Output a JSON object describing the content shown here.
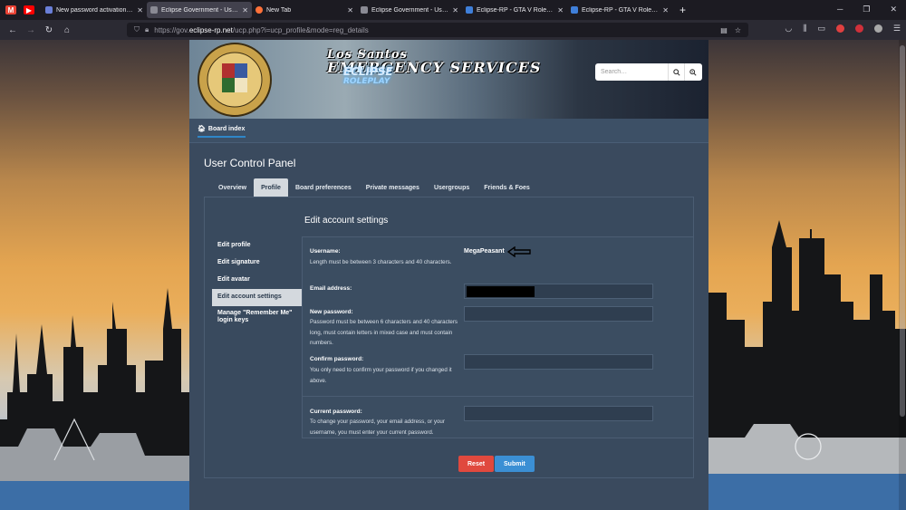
{
  "browser": {
    "tabs": [
      {
        "title": "New password activation - dj",
        "color": "#6a7fd8",
        "active": false
      },
      {
        "title": "Eclipse Government - User Con",
        "color": "#8a8a94",
        "active": true
      },
      {
        "title": "New Tab",
        "color": "#ff7139",
        "active": false
      },
      {
        "title": "Eclipse Government - User Con",
        "color": "#8a8a94",
        "active": false
      },
      {
        "title": "Eclipse-RP - GTA V Roleplay Se",
        "color": "#3f7fd9",
        "active": false
      },
      {
        "title": "Eclipse-RP - GTA V Roleplaying",
        "color": "#3f7fd9",
        "active": false
      }
    ],
    "url": {
      "prefix": "https://gov.",
      "domain": "eclipse-rp.net",
      "path": "/ucp.php?i=ucp_profile&mode=reg_details"
    }
  },
  "banner": {
    "title_line1": "Los Santos",
    "title_line2": "EMERGENCY SERVICES",
    "eclipse": "ECLIPSE",
    "eclipse_sub": "ROLEPLAY",
    "search_placeholder": "Search…"
  },
  "nav": {
    "board_index": "Board index"
  },
  "ucp": {
    "title": "User Control Panel",
    "tabs": [
      "Overview",
      "Profile",
      "Board preferences",
      "Private messages",
      "Usergroups",
      "Friends & Foes"
    ],
    "selected_tab": "Profile",
    "heading": "Edit account settings",
    "menu": [
      "Edit profile",
      "Edit signature",
      "Edit avatar",
      "Edit account settings",
      "Manage \"Remember Me\" login keys"
    ],
    "selected_menu": "Edit account settings"
  },
  "form": {
    "username_label": "Username:",
    "username_hint": "Length must be between 3 characters and 40 characters.",
    "username_value": "MegaPeasant",
    "email_label": "Email address:",
    "newpw_label": "New password:",
    "newpw_hint": "Password must be between 6 characters and 40 characters long, must contain letters in mixed case and must contain numbers.",
    "confirm_label": "Confirm password:",
    "confirm_hint": "You only need to confirm your password if you changed it above.",
    "current_label": "Current password:",
    "current_hint": "To change your password, your email address, or your username, you must enter your current password."
  },
  "buttons": {
    "reset": "Reset",
    "submit": "Submit"
  },
  "colors": {
    "reset": "#e0493e",
    "submit": "#3b8fd4",
    "panel": "#394a5e",
    "accent": "#2f86c8"
  }
}
